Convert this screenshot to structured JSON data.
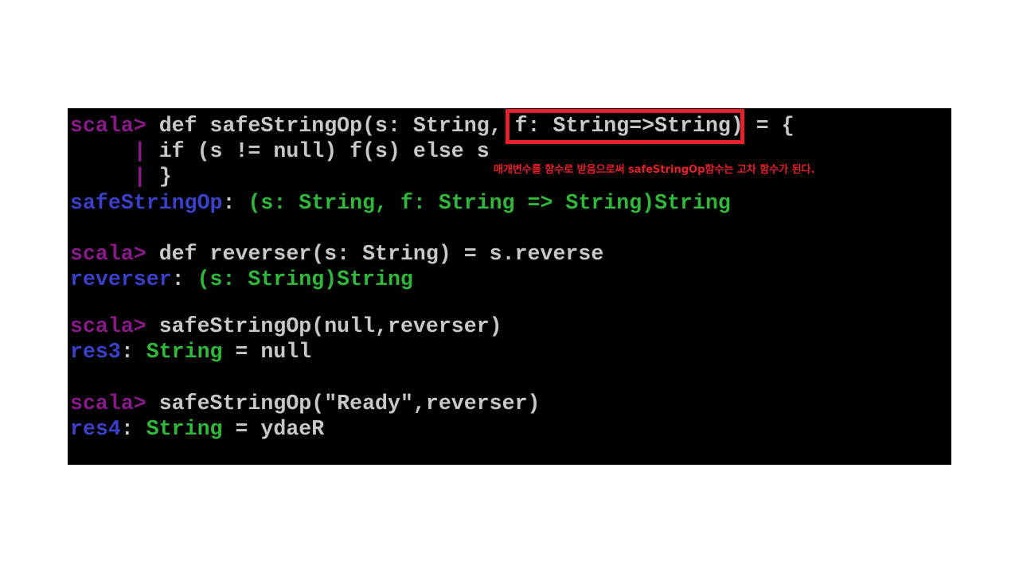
{
  "terminal": {
    "lines": [
      {
        "prompt": "scala>",
        "text": " def safeStringOp(s: String, f: String=>String) = {"
      },
      {
        "prompt": "     |",
        "text": " if (s != null) f(s) else s"
      },
      {
        "prompt": "     |",
        "text": " }"
      },
      {
        "name": "safeStringOp",
        "sep": ": ",
        "type": "(s: String, f: String => String)String"
      },
      {
        "prompt": "scala>",
        "text": " def reverser(s: String) = s.reverse"
      },
      {
        "name": "reverser",
        "sep": ": ",
        "type": "(s: String)String"
      },
      {
        "prompt": "scala>",
        "text": " safeStringOp(null,reverser)"
      },
      {
        "name": "res3",
        "sep": ": ",
        "type": "String",
        "rest": " = null"
      },
      {
        "prompt": "scala>",
        "text": " safeStringOp(\"Ready\",reverser)"
      },
      {
        "name": "res4",
        "sep": ": ",
        "type": "String",
        "rest": " = ydaeR"
      }
    ]
  },
  "annotation": {
    "text": "매개변수를 함수로 받음으로써 safeStringOp함수는 고차 함수가 된다.",
    "color": "#e8202a"
  },
  "colors": {
    "background": "#000000",
    "prompt": "#8a1a8a",
    "name": "#3a40c8",
    "type": "#2fb83a",
    "text": "#c8c8c8"
  }
}
